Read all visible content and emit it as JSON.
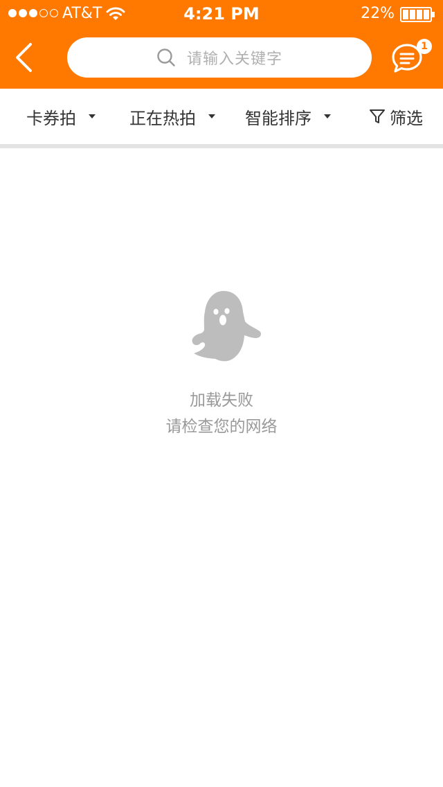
{
  "status_bar": {
    "carrier": "AT&T",
    "time": "4:21 PM",
    "battery_percent": "22%",
    "signal_bars_filled": 3,
    "signal_bars_total": 5,
    "battery_level": 0.22
  },
  "nav": {
    "back_icon": "chevron-left-icon",
    "search": {
      "placeholder": "请输入关键字",
      "icon": "search-icon"
    },
    "messages": {
      "icon": "chat-bubble-icon",
      "badge_count": "1"
    }
  },
  "filters": {
    "items": [
      {
        "label": "卡券拍",
        "icon": "caret-down-icon"
      },
      {
        "label": "正在热拍",
        "icon": "caret-down-icon"
      },
      {
        "label": "智能排序",
        "icon": "caret-down-icon"
      },
      {
        "label": "筛选",
        "icon": "funnel-icon"
      }
    ]
  },
  "empty_state": {
    "icon": "ghost-icon",
    "title": "加载失败",
    "subtitle": "请检查您的网络"
  },
  "colors": {
    "brand": "#ff7800",
    "text_primary": "#333333",
    "text_muted": "#999999",
    "placeholder": "#b0b0b0",
    "ghost": "#bdbdbd",
    "divider": "#e3e3e3"
  }
}
